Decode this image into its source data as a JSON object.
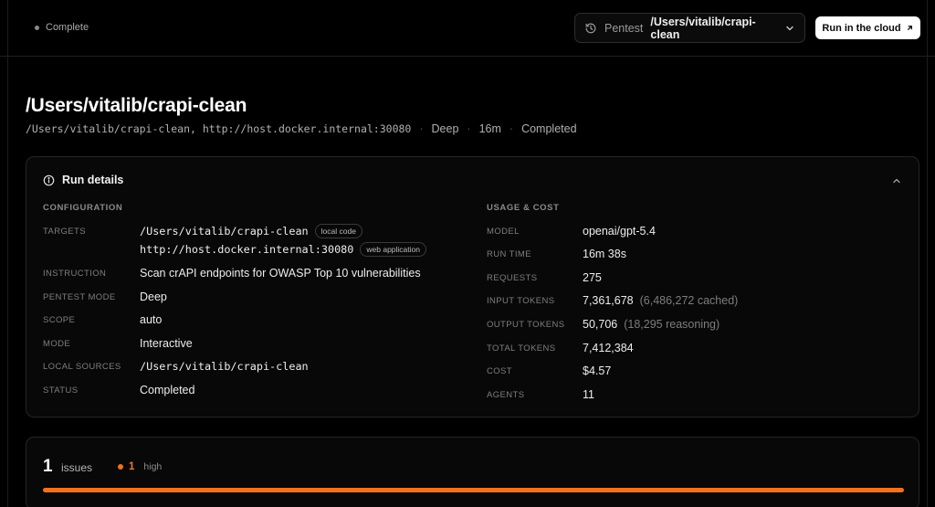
{
  "topbar": {
    "status": "Complete",
    "context_kind": "Pentest",
    "context_path": "/Users/vitalib/crapi-clean",
    "cloud_button": "Run in the cloud"
  },
  "header": {
    "title": "/Users/vitalib/crapi-clean",
    "targets_line": "/Users/vitalib/crapi-clean, http://host.docker.internal:30080",
    "mode": "Deep",
    "duration": "16m",
    "status": "Completed",
    "separator": "·"
  },
  "run_details": {
    "title": "Run details",
    "configuration": {
      "label": "CONFIGURATION",
      "targets_key": "TARGETS",
      "targets": [
        {
          "value": "/Users/vitalib/crapi-clean",
          "tag": "local code"
        },
        {
          "value": "http://host.docker.internal:30080",
          "tag": "web application"
        }
      ],
      "instruction_key": "INSTRUCTION",
      "instruction": "Scan crAPI endpoints for OWASP Top 10 vulnerabilities",
      "pentest_mode_key": "PENTEST MODE",
      "pentest_mode": "Deep",
      "scope_key": "SCOPE",
      "scope": "auto",
      "mode_key": "MODE",
      "mode": "Interactive",
      "local_sources_key": "LOCAL SOURCES",
      "local_sources": "/Users/vitalib/crapi-clean",
      "status_key": "STATUS",
      "status": "Completed"
    },
    "usage": {
      "label": "USAGE & COST",
      "model_key": "MODEL",
      "model": "openai/gpt-5.4",
      "run_time_key": "RUN TIME",
      "run_time": "16m 38s",
      "requests_key": "REQUESTS",
      "requests": "275",
      "input_tokens_key": "INPUT TOKENS",
      "input_tokens": "7,361,678",
      "input_tokens_note": "(6,486,272 cached)",
      "output_tokens_key": "OUTPUT TOKENS",
      "output_tokens": "50,706",
      "output_tokens_note": "(18,295 reasoning)",
      "total_tokens_key": "TOTAL TOKENS",
      "total_tokens": "7,412,384",
      "cost_key": "COST",
      "cost": "$4.57",
      "agents_key": "AGENTS",
      "agents": "11"
    }
  },
  "issues": {
    "count": "1",
    "label": "issues",
    "severity_count": "1",
    "severity_label": "high",
    "severity_color": "#f2711c",
    "high_fraction": 1.0
  },
  "icons": {
    "status": "status-dot-icon",
    "history": "history-icon",
    "chevron": "chevron-down-icon",
    "external": "arrow-up-right-icon",
    "info": "info-icon",
    "collapse": "chevron-up-icon"
  }
}
